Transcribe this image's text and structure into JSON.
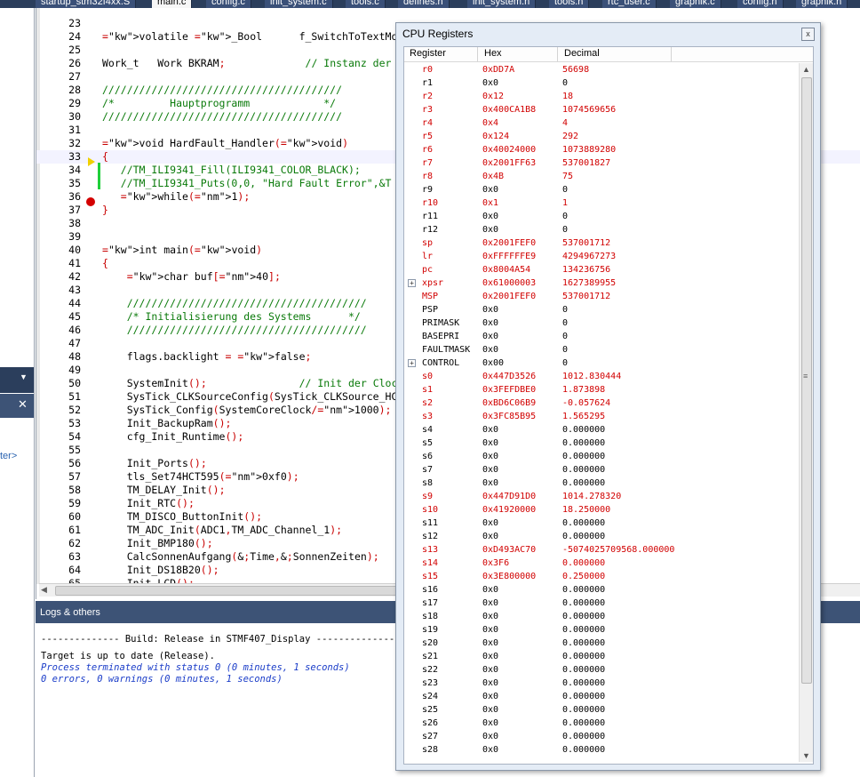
{
  "tabs": [
    "startup_stm32f4xx.S",
    "main.c",
    "config.c",
    "init_system.c",
    "tools.c",
    "defines.h",
    "init_system.h",
    "tools.h",
    "rtc_user.c",
    "graphik.c",
    "config.h",
    "graphik.h"
  ],
  "active_tab": "main.c",
  "left_panel_text": "ter>",
  "code_lines": [
    {
      "n": "23",
      "t": ""
    },
    {
      "n": "24",
      "t": "volatile _Bool      f_SwitchToTextMode = false;"
    },
    {
      "n": "25",
      "t": ""
    },
    {
      "n": "26",
      "t": "Work_t   Work BKRAM;             // Instanz der"
    },
    {
      "n": "27",
      "t": ""
    },
    {
      "n": "28",
      "t": "///////////////////////////////////////"
    },
    {
      "n": "29",
      "t": "/*         Hauptprogramm            */"
    },
    {
      "n": "30",
      "t": "///////////////////////////////////////"
    },
    {
      "n": "31",
      "t": ""
    },
    {
      "n": "32",
      "t": "void HardFault_Handler(void)"
    },
    {
      "n": "33",
      "t": "{"
    },
    {
      "n": "34",
      "t": "   //TM_ILI9341_Fill(ILI9341_COLOR_BLACK);"
    },
    {
      "n": "35",
      "t": "   //TM_ILI9341_Puts(0,0, \"Hard Fault Error\",&T"
    },
    {
      "n": "36",
      "t": "   while(1);"
    },
    {
      "n": "37",
      "t": "}"
    },
    {
      "n": "38",
      "t": ""
    },
    {
      "n": "39",
      "t": ""
    },
    {
      "n": "40",
      "t": "int main(void)"
    },
    {
      "n": "41",
      "t": "{"
    },
    {
      "n": "42",
      "t": "    char buf[40];"
    },
    {
      "n": "43",
      "t": ""
    },
    {
      "n": "44",
      "t": "    ///////////////////////////////////////"
    },
    {
      "n": "45",
      "t": "    /* Initialisierung des Systems      */"
    },
    {
      "n": "46",
      "t": "    ///////////////////////////////////////"
    },
    {
      "n": "47",
      "t": ""
    },
    {
      "n": "48",
      "t": "    flags.backlight = false;"
    },
    {
      "n": "49",
      "t": ""
    },
    {
      "n": "50",
      "t": "    SystemInit();               // Init der Cloc"
    },
    {
      "n": "51",
      "t": "    SysTick_CLKSourceConfig(SysTick_CLKSource_HC"
    },
    {
      "n": "52",
      "t": "    SysTick_Config(SystemCoreClock/1000);"
    },
    {
      "n": "53",
      "t": "    Init_BackupRam();"
    },
    {
      "n": "54",
      "t": "    cfg_Init_Runtime();"
    },
    {
      "n": "55",
      "t": ""
    },
    {
      "n": "56",
      "t": "    Init_Ports();"
    },
    {
      "n": "57",
      "t": "    tls_Set74HCT595(0xf0);"
    },
    {
      "n": "58",
      "t": "    TM_DELAY_Init();"
    },
    {
      "n": "59",
      "t": "    Init_RTC();"
    },
    {
      "n": "60",
      "t": "    TM_DISCO_ButtonInit();"
    },
    {
      "n": "61",
      "t": "    TM_ADC_Init(ADC1,TM_ADC_Channel_1);"
    },
    {
      "n": "62",
      "t": "    Init_BMP180();"
    },
    {
      "n": "63",
      "t": "    CalcSonnenAufgang(&Time,&SonnenZeiten);"
    },
    {
      "n": "64",
      "t": "    Init_DS18B20();"
    },
    {
      "n": "65",
      "t": "    Init_LCD();"
    }
  ],
  "logs": {
    "title": "Logs & others",
    "lines": [
      "-------------- Build: Release in STMF407_Display ---------------",
      "Target is up to date (Release).",
      "Process terminated with status 0 (0 minutes, 1 seconds)",
      "0 errors, 0 warnings (0 minutes, 1 seconds)"
    ]
  },
  "cpu": {
    "title": "CPU Registers",
    "headers": {
      "register": "Register",
      "hex": "Hex",
      "decimal": "Decimal"
    },
    "close_label": "x",
    "registers": [
      {
        "name": "r0",
        "hex": "0xDD7A",
        "dec": "56698",
        "changed": true
      },
      {
        "name": "r1",
        "hex": "0x0",
        "dec": "0",
        "changed": false
      },
      {
        "name": "r2",
        "hex": "0x12",
        "dec": "18",
        "changed": true
      },
      {
        "name": "r3",
        "hex": "0x400CA1B8",
        "dec": "1074569656",
        "changed": true
      },
      {
        "name": "r4",
        "hex": "0x4",
        "dec": "4",
        "changed": true
      },
      {
        "name": "r5",
        "hex": "0x124",
        "dec": "292",
        "changed": true
      },
      {
        "name": "r6",
        "hex": "0x40024000",
        "dec": "1073889280",
        "changed": true
      },
      {
        "name": "r7",
        "hex": "0x2001FF63",
        "dec": "537001827",
        "changed": true
      },
      {
        "name": "r8",
        "hex": "0x4B",
        "dec": "75",
        "changed": true
      },
      {
        "name": "r9",
        "hex": "0x0",
        "dec": "0",
        "changed": false
      },
      {
        "name": "r10",
        "hex": "0x1",
        "dec": "1",
        "changed": true
      },
      {
        "name": "r11",
        "hex": "0x0",
        "dec": "0",
        "changed": false
      },
      {
        "name": "r12",
        "hex": "0x0",
        "dec": "0",
        "changed": false
      },
      {
        "name": "sp",
        "hex": "0x2001FEF0",
        "dec": "537001712",
        "changed": true
      },
      {
        "name": "lr",
        "hex": "0xFFFFFFE9",
        "dec": "4294967273",
        "changed": true
      },
      {
        "name": "pc",
        "hex": "0x8004A54",
        "dec": "134236756",
        "changed": true
      },
      {
        "name": "xpsr",
        "hex": "0x61000003",
        "dec": "1627389955",
        "changed": true,
        "expand": true
      },
      {
        "name": "MSP",
        "hex": "0x2001FEF0",
        "dec": "537001712",
        "changed": true
      },
      {
        "name": "PSP",
        "hex": "0x0",
        "dec": "0",
        "changed": false
      },
      {
        "name": "PRIMASK",
        "hex": "0x0",
        "dec": "0",
        "changed": false
      },
      {
        "name": "BASEPRI",
        "hex": "0x0",
        "dec": "0",
        "changed": false
      },
      {
        "name": "FAULTMASK",
        "hex": "0x0",
        "dec": "0",
        "changed": false
      },
      {
        "name": "CONTROL",
        "hex": "0x00",
        "dec": "0",
        "changed": false,
        "expand": true
      },
      {
        "name": "s0",
        "hex": "0x447D3526",
        "dec": "1012.830444",
        "changed": true
      },
      {
        "name": "s1",
        "hex": "0x3FEFDBE0",
        "dec": "1.873898",
        "changed": true
      },
      {
        "name": "s2",
        "hex": "0xBD6C06B9",
        "dec": "-0.057624",
        "changed": true
      },
      {
        "name": "s3",
        "hex": "0x3FC85B95",
        "dec": "1.565295",
        "changed": true
      },
      {
        "name": "s4",
        "hex": "0x0",
        "dec": "0.000000",
        "changed": false
      },
      {
        "name": "s5",
        "hex": "0x0",
        "dec": "0.000000",
        "changed": false
      },
      {
        "name": "s6",
        "hex": "0x0",
        "dec": "0.000000",
        "changed": false
      },
      {
        "name": "s7",
        "hex": "0x0",
        "dec": "0.000000",
        "changed": false
      },
      {
        "name": "s8",
        "hex": "0x0",
        "dec": "0.000000",
        "changed": false
      },
      {
        "name": "s9",
        "hex": "0x447D91D0",
        "dec": "1014.278320",
        "changed": true
      },
      {
        "name": "s10",
        "hex": "0x41920000",
        "dec": "18.250000",
        "changed": true
      },
      {
        "name": "s11",
        "hex": "0x0",
        "dec": "0.000000",
        "changed": false
      },
      {
        "name": "s12",
        "hex": "0x0",
        "dec": "0.000000",
        "changed": false
      },
      {
        "name": "s13",
        "hex": "0xD493AC70",
        "dec": "-5074025709568.000000",
        "changed": true
      },
      {
        "name": "s14",
        "hex": "0x3F6",
        "dec": "0.000000",
        "changed": true
      },
      {
        "name": "s15",
        "hex": "0x3E800000",
        "dec": "0.250000",
        "changed": true
      },
      {
        "name": "s16",
        "hex": "0x0",
        "dec": "0.000000",
        "changed": false
      },
      {
        "name": "s17",
        "hex": "0x0",
        "dec": "0.000000",
        "changed": false
      },
      {
        "name": "s18",
        "hex": "0x0",
        "dec": "0.000000",
        "changed": false
      },
      {
        "name": "s19",
        "hex": "0x0",
        "dec": "0.000000",
        "changed": false
      },
      {
        "name": "s20",
        "hex": "0x0",
        "dec": "0.000000",
        "changed": false
      },
      {
        "name": "s21",
        "hex": "0x0",
        "dec": "0.000000",
        "changed": false
      },
      {
        "name": "s22",
        "hex": "0x0",
        "dec": "0.000000",
        "changed": false
      },
      {
        "name": "s23",
        "hex": "0x0",
        "dec": "0.000000",
        "changed": false
      },
      {
        "name": "s24",
        "hex": "0x0",
        "dec": "0.000000",
        "changed": false
      },
      {
        "name": "s25",
        "hex": "0x0",
        "dec": "0.000000",
        "changed": false
      },
      {
        "name": "s26",
        "hex": "0x0",
        "dec": "0.000000",
        "changed": false
      },
      {
        "name": "s27",
        "hex": "0x0",
        "dec": "0.000000",
        "changed": false
      },
      {
        "name": "s28",
        "hex": "0x0",
        "dec": "0.000000",
        "changed": false
      }
    ]
  },
  "colors": {
    "changed_register": "#d10000",
    "title_bar": "#3d5376",
    "comment": "#0a7a0a",
    "keyword": "#00008b"
  }
}
